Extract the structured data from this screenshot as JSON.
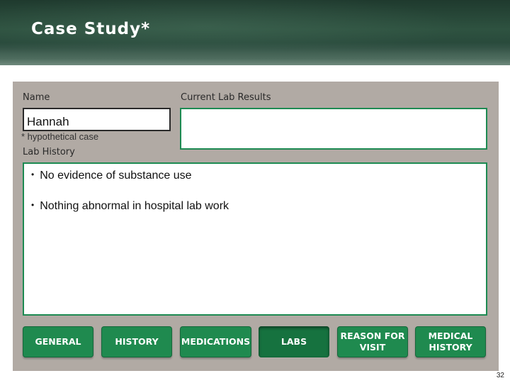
{
  "slide": {
    "title": "Case Study*",
    "page_number": "32"
  },
  "form": {
    "name_label": "Name",
    "name_value": "Hannah",
    "footnote": "* hypothetical case",
    "current_lab_label": "Current Lab Results",
    "current_lab_value": "",
    "lab_history_label": "Lab History",
    "lab_history_items": [
      "No evidence of substance use",
      "Nothing abnormal in hospital lab work"
    ]
  },
  "nav": {
    "active": "LABS",
    "buttons": [
      {
        "label": "GENERAL"
      },
      {
        "label": "HISTORY"
      },
      {
        "label": "MEDICATIONS"
      },
      {
        "label": "LABS"
      },
      {
        "label": "REASON FOR\nVISIT"
      },
      {
        "label": "MEDICAL\nHISTORY"
      }
    ]
  },
  "colors": {
    "header": "#2e5240",
    "panel": "#b1aaa4",
    "button": "#1f8a4f",
    "field_border": "#1d8a52"
  }
}
